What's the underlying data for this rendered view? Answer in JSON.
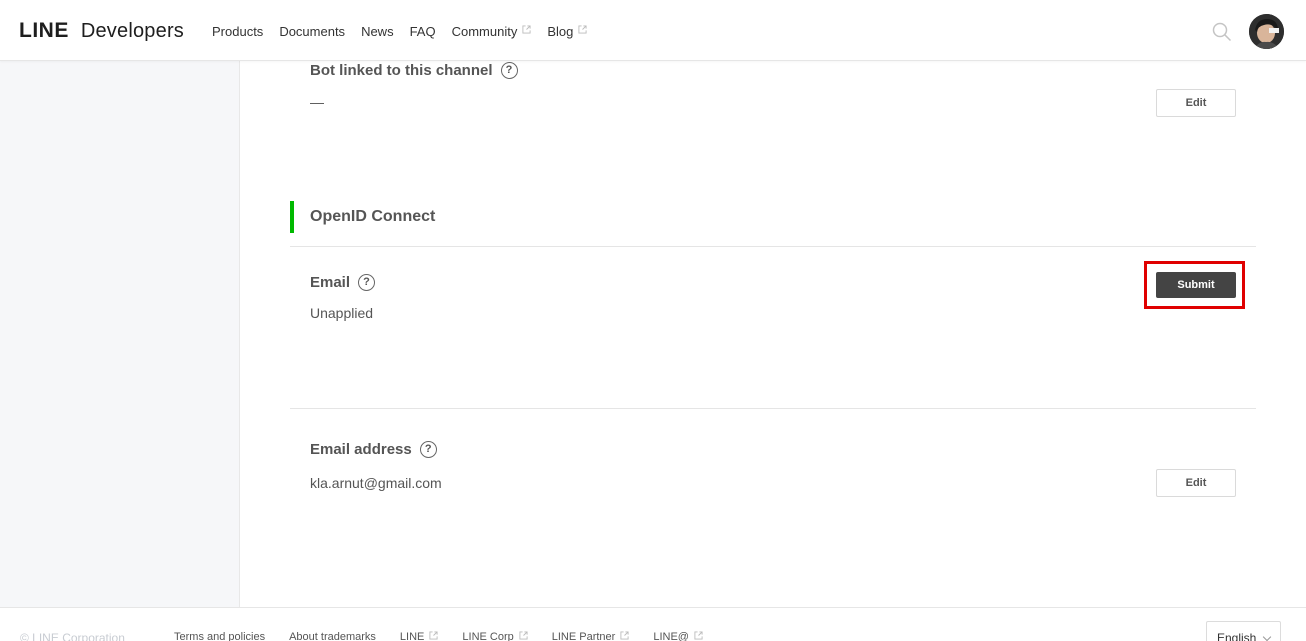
{
  "header": {
    "logo_line": "LINE",
    "logo_developers": "Developers",
    "nav": [
      {
        "label": "Products",
        "external": false
      },
      {
        "label": "Documents",
        "external": false
      },
      {
        "label": "News",
        "external": false
      },
      {
        "label": "FAQ",
        "external": false
      },
      {
        "label": "Community",
        "external": true
      },
      {
        "label": "Blog",
        "external": true
      }
    ],
    "search_icon": "search-icon",
    "avatar_icon": "user-avatar"
  },
  "bot_linked": {
    "title": "Bot linked to this channel",
    "value": "—",
    "edit_label": "Edit"
  },
  "openid": {
    "section_title": "OpenID Connect",
    "email": {
      "title": "Email",
      "value": "Unapplied",
      "submit_label": "Submit"
    }
  },
  "email_address": {
    "title": "Email address",
    "value": "kla.arnut@gmail.com",
    "edit_label": "Edit"
  },
  "help_symbol": "?",
  "footer": {
    "copyright": "© LINE Corporation",
    "links": [
      {
        "label": "Terms and policies",
        "external": false
      },
      {
        "label": "About trademarks",
        "external": false
      },
      {
        "label": "LINE",
        "external": true
      },
      {
        "label": "LINE Corp",
        "external": true
      },
      {
        "label": "LINE Partner",
        "external": true
      },
      {
        "label": "LINE@",
        "external": true
      }
    ],
    "language": "English"
  },
  "colors": {
    "accent_green": "#00b900",
    "highlight_red": "#e00000",
    "submit_bg": "#444444"
  }
}
